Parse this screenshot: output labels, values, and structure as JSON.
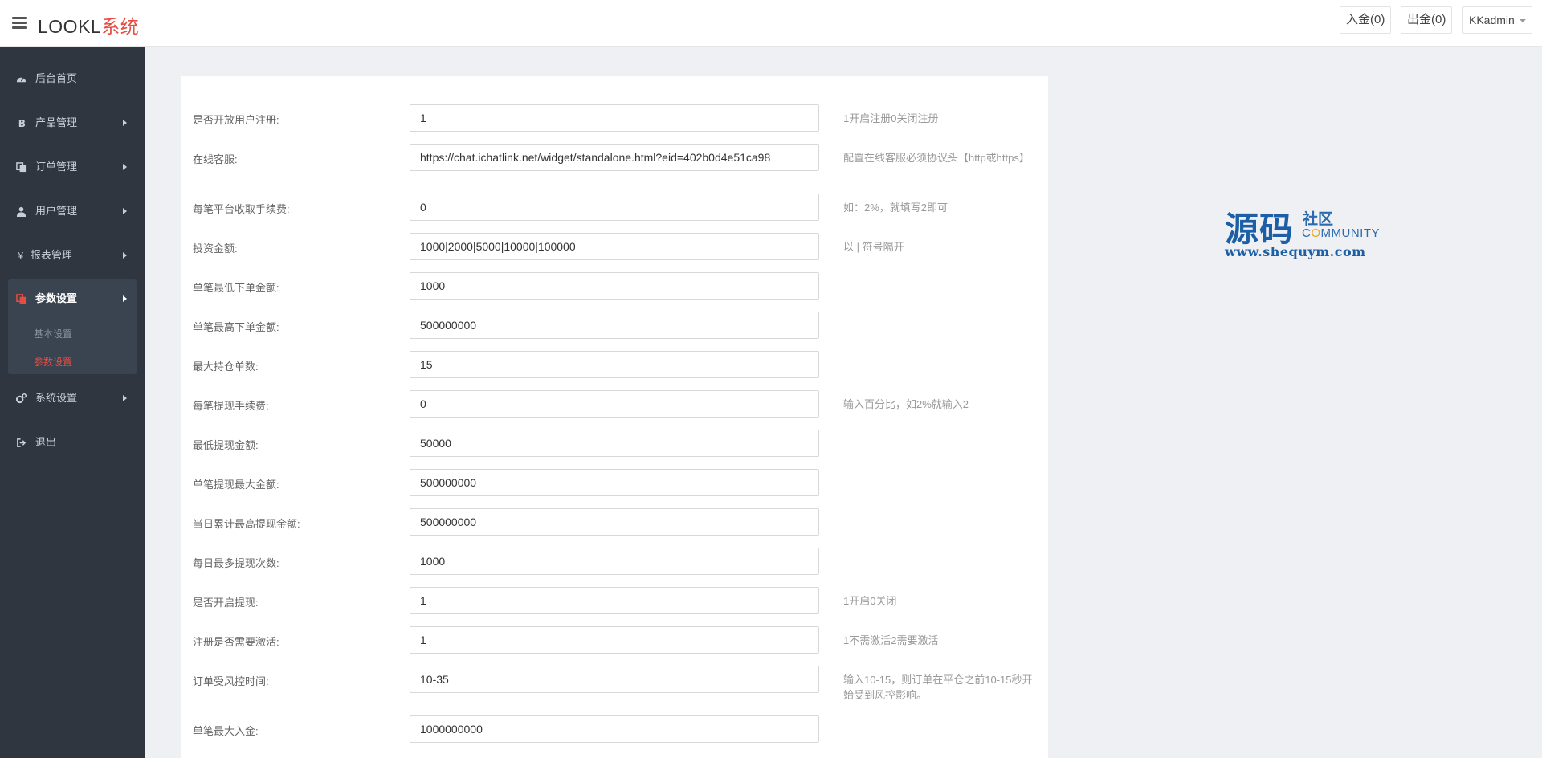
{
  "header": {
    "brand_prefix": "LOOKL",
    "brand_suffix": "系统",
    "deposit_label": "入金(0)",
    "withdraw_label": "出金(0)",
    "user_label": "KKadmin"
  },
  "sidebar": {
    "items": [
      {
        "label": "后台首页",
        "icon": "dashboard-icon"
      },
      {
        "label": "产品管理",
        "icon": "bitcoin-icon"
      },
      {
        "label": "订单管理",
        "icon": "copy-icon"
      },
      {
        "label": "用户管理",
        "icon": "user-icon"
      },
      {
        "label": "报表管理",
        "icon": "yen-icon"
      },
      {
        "label": "参数设置",
        "icon": "copy-icon"
      },
      {
        "label": "系统设置",
        "icon": "gears-icon"
      },
      {
        "label": "退出",
        "icon": "sign-out-icon"
      }
    ],
    "sub_items": [
      "基本设置",
      "参数设置"
    ],
    "active_color": "#e54d42"
  },
  "form": {
    "rows": [
      {
        "label": "是否开放用户注册:",
        "value": "1",
        "hint": "1开启注册0关闭注册"
      },
      {
        "label": "在线客服:",
        "value": "https://chat.ichatlink.net/widget/standalone.html?eid=402b0d4e51ca98",
        "hint": "配置在线客服必须协议头【http或https】"
      },
      {
        "label": "每笔平台收取手续费:",
        "value": "0",
        "hint": "如：2%，就填写2即可"
      },
      {
        "label": "投资金额:",
        "value": "1000|2000|5000|10000|100000",
        "hint": "以 | 符号隔开"
      },
      {
        "label": "单笔最低下单金额:",
        "value": "1000",
        "hint": ""
      },
      {
        "label": "单笔最高下单金额:",
        "value": "500000000",
        "hint": ""
      },
      {
        "label": "最大持仓单数:",
        "value": "15",
        "hint": ""
      },
      {
        "label": "每笔提现手续费:",
        "value": "0",
        "hint": "输入百分比，如2%就输入2"
      },
      {
        "label": "最低提现金额:",
        "value": "50000",
        "hint": ""
      },
      {
        "label": "单笔提现最大金额:",
        "value": "500000000",
        "hint": ""
      },
      {
        "label": "当日累计最高提现金额:",
        "value": "500000000",
        "hint": ""
      },
      {
        "label": "每日最多提现次数:",
        "value": "1000",
        "hint": ""
      },
      {
        "label": "是否开启提现:",
        "value": "1",
        "hint": "1开启0关闭"
      },
      {
        "label": "注册是否需要激活:",
        "value": "1",
        "hint": "1不需激活2需要激活"
      },
      {
        "label": "订单受风控时间:",
        "value": "10-35",
        "hint": "输入10-15，则订单在平仓之前10-15秒开始受到风控影响。"
      },
      {
        "label": "单笔最大入金:",
        "value": "1000000000",
        "hint": ""
      }
    ]
  },
  "watermark": {
    "big": "源码",
    "small": "社区",
    "community_c": "C",
    "community_o": "O",
    "community_rest": "MMUNITY",
    "url": "www.shequym.com"
  }
}
